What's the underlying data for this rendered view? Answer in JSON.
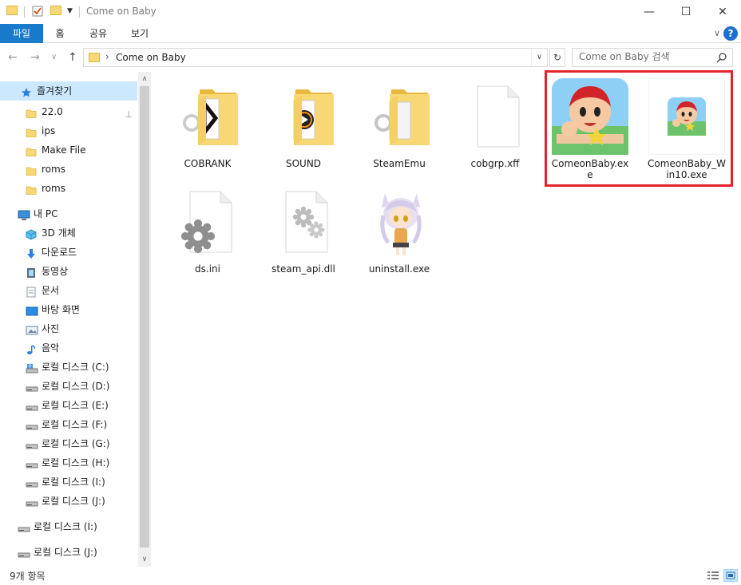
{
  "window": {
    "title": "Come on Baby",
    "minimize_glyph": "—",
    "maximize_glyph": "☐",
    "close_glyph": "✕"
  },
  "ribbon": {
    "tabs": [
      "파일",
      "홈",
      "공유",
      "보기"
    ],
    "expand_glyph": "∨",
    "help_glyph": "?"
  },
  "navbar": {
    "back_glyph": "←",
    "forward_glyph": "→",
    "recent_glyph": "∨",
    "up_glyph": "↑",
    "path_separator": "›",
    "path": "Come on Baby",
    "dropdown_glyph": "∨",
    "refresh_glyph": "↻",
    "search_placeholder": "Come on Baby 검색"
  },
  "nav_pane": {
    "items": [
      {
        "label": "즐겨찾기",
        "icon": "star-icon"
      },
      {
        "label": "22.0",
        "icon": "folder-icon",
        "pinned": true
      },
      {
        "label": "ips",
        "icon": "folder-icon"
      },
      {
        "label": "Make File",
        "icon": "folder-icon"
      },
      {
        "label": "roms",
        "icon": "folder-icon"
      },
      {
        "label": "roms",
        "icon": "folder-icon"
      },
      {
        "label": "내 PC",
        "icon": "computer-icon"
      },
      {
        "label": "3D 개체",
        "icon": "cube-icon"
      },
      {
        "label": "다운로드",
        "icon": "download-icon"
      },
      {
        "label": "동영상",
        "icon": "video-icon"
      },
      {
        "label": "문서",
        "icon": "document-icon"
      },
      {
        "label": "바탕 화면",
        "icon": "desktop-icon"
      },
      {
        "label": "사진",
        "icon": "picture-icon"
      },
      {
        "label": "음악",
        "icon": "music-icon"
      },
      {
        "label": "로컬 디스크 (C:)",
        "icon": "system-drive-icon"
      },
      {
        "label": "로컬 디스크 (D:)",
        "icon": "drive-icon"
      },
      {
        "label": "로컬 디스크 (E:)",
        "icon": "drive-icon"
      },
      {
        "label": "로컬 디스크 (F:)",
        "icon": "drive-icon"
      },
      {
        "label": "로컬 디스크 (G:)",
        "icon": "drive-icon"
      },
      {
        "label": "로컬 디스크 (H:)",
        "icon": "drive-icon"
      },
      {
        "label": "로컬 디스크 (I:)",
        "icon": "drive-icon"
      },
      {
        "label": "로컬 디스크 (J:)",
        "icon": "drive-icon"
      },
      {
        "label": "로컬 디스크 (I:)",
        "icon": "drive-icon"
      },
      {
        "label": "로컬 디스크 (J:)",
        "icon": "drive-icon"
      }
    ],
    "pin_glyph": "⊥",
    "scroll_up_glyph": "∧",
    "scroll_down_glyph": "∨"
  },
  "files": [
    {
      "name": "COBRANK",
      "type": "folder"
    },
    {
      "name": "SOUND",
      "type": "folder"
    },
    {
      "name": "SteamEmu",
      "type": "folder"
    },
    {
      "name": "cobgrp.xff",
      "type": "blank-file"
    },
    {
      "name": "ComeonBaby.exe",
      "type": "app"
    },
    {
      "name": "ComeonBaby_Win10.exe",
      "type": "app-small"
    },
    {
      "name": "ds.ini",
      "type": "settings-file"
    },
    {
      "name": "steam_api.dll",
      "type": "dll-file"
    },
    {
      "name": "uninstall.exe",
      "type": "anime-app"
    }
  ],
  "status": {
    "item_count": "9개 항목"
  },
  "colors": {
    "accent": "#1979ca",
    "selection": "#cce8ff",
    "highlight_box": "#e3242b",
    "folder": "#f8d775"
  }
}
